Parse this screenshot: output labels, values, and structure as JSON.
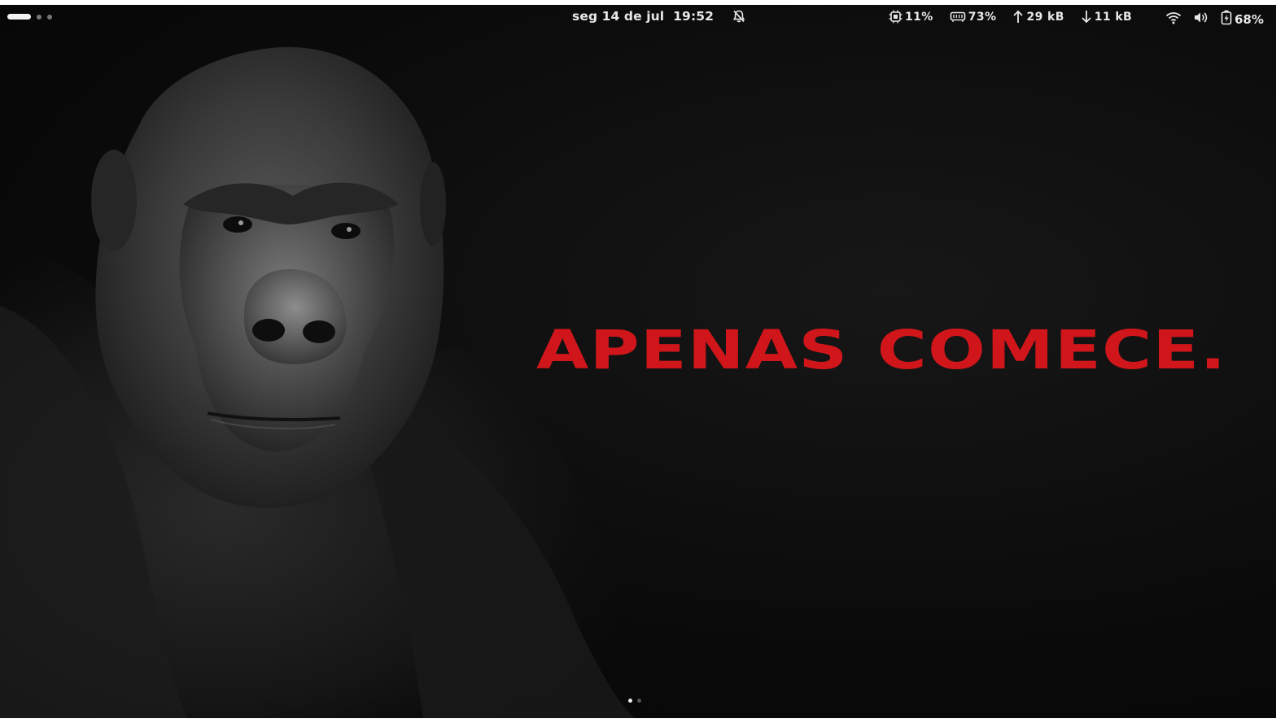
{
  "topbar": {
    "date": "seg 14 de jul",
    "time": "19:52",
    "cpu": "11%",
    "memory": "73%",
    "upload": "29 kB",
    "download": "11 kB",
    "battery": "68%",
    "icons": [
      "notifications-off-icon",
      "cpu-icon",
      "memory-icon",
      "upload-arrow-icon",
      "download-arrow-icon",
      "wifi-icon",
      "volume-icon",
      "battery-charging-icon"
    ]
  },
  "wallpaper": {
    "headline": "APENAS COMECE.",
    "headline_color": "#d0161b",
    "subject": "gorilla-portrait"
  },
  "workspaces": {
    "count": 3,
    "active": 1
  },
  "pages": {
    "count": 2,
    "active": 1
  }
}
